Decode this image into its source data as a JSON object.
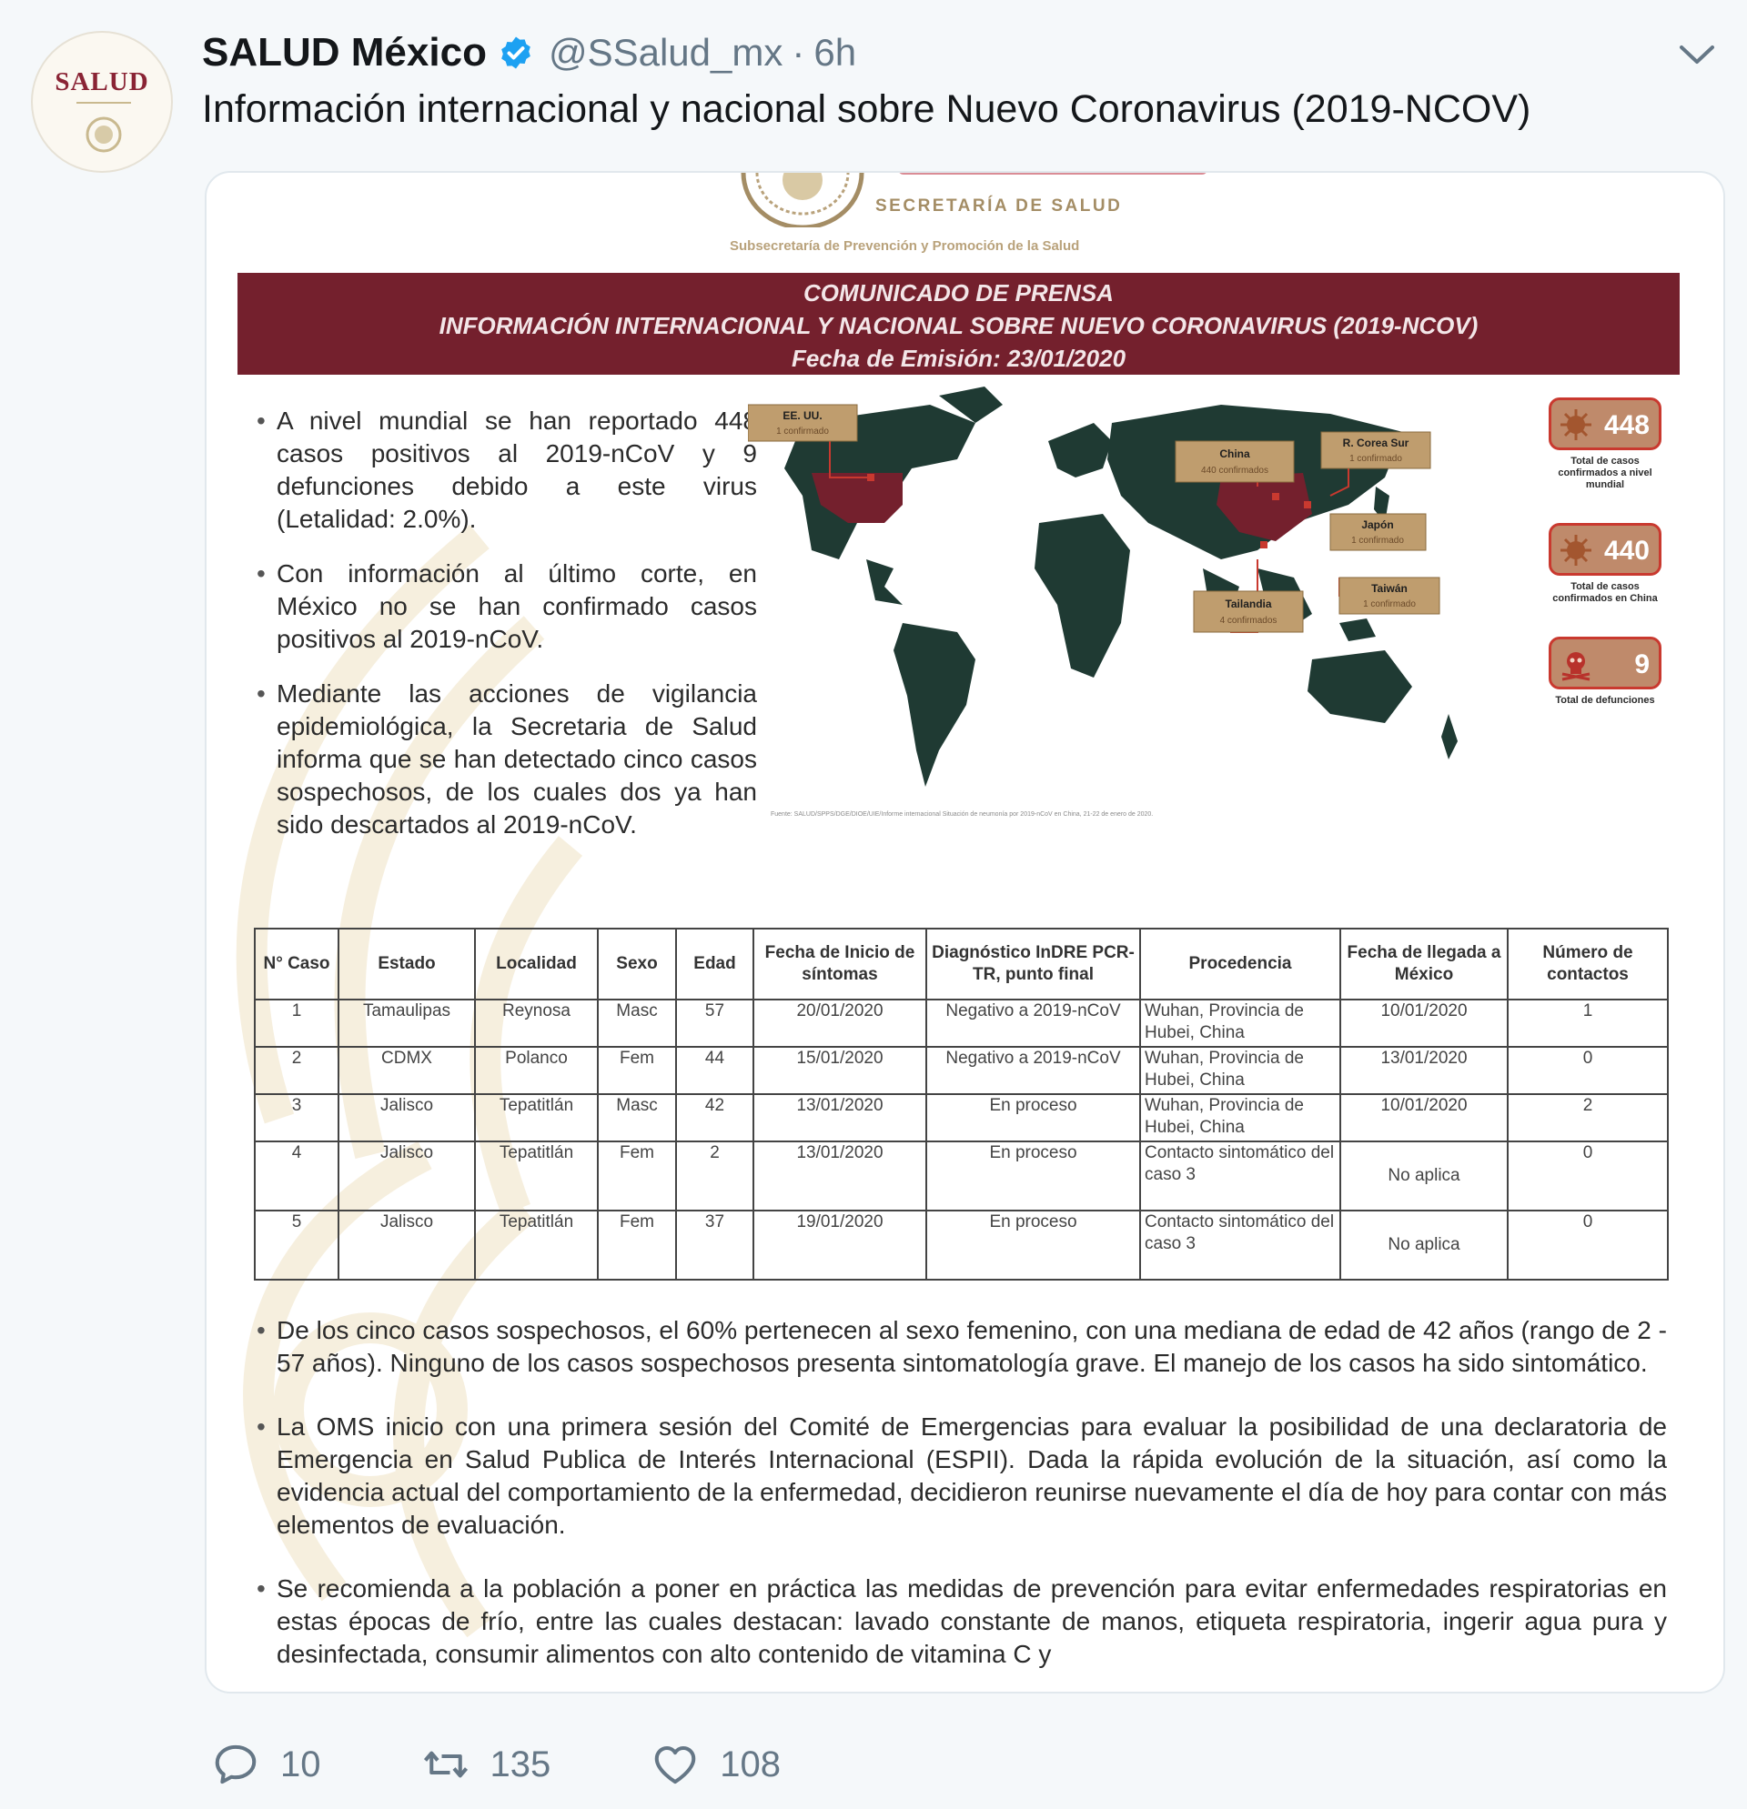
{
  "author": {
    "display_name": "SALUD México",
    "handle": "@SSalud_mx",
    "separator": "·",
    "time": "6h",
    "avatar_text": "SALUD"
  },
  "tweet_text": "Información internacional y nacional sobre Nuevo Coronavirus (2019-NCOV)",
  "document": {
    "org": "SECRETARÍA DE SALUD",
    "suborg": "Subsecretaría de Prevención y Promoción de la Salud",
    "banner": [
      "COMUNICADO DE PRENSA",
      "INFORMACIÓN INTERNACIONAL Y NACIONAL SOBRE NUEVO CORONAVIRUS (2019-NCOV)",
      "Fecha de Emisión: 23/01/2020"
    ],
    "bullets_top": [
      "A nivel mundial se han reportado 448 casos positivos al 2019-nCoV y 9 defunciones debido a este virus (Letalidad: 2.0%).",
      "Con información al último corte, en México no se han confirmado casos positivos al 2019-nCoV.",
      "Mediante las acciones de vigilancia epidemiológica, la Secretaria de Salud informa que se han detectado cinco casos sospechosos, de los cuales dos ya han sido descartados al 2019-nCoV."
    ],
    "map_labels": [
      {
        "name": "EE. UU.",
        "detail": "1 confirmado"
      },
      {
        "name": "China",
        "detail": "440 confirmados"
      },
      {
        "name": "R. Corea Sur",
        "detail": "1 confirmado"
      },
      {
        "name": "Japón",
        "detail": "1 confirmado"
      },
      {
        "name": "Tailandia",
        "detail": "4 confirmados"
      },
      {
        "name": "Taiwán",
        "detail": "1 confirmado"
      }
    ],
    "stats": [
      {
        "value": "448",
        "desc": "Total de casos confirmados a nivel mundial"
      },
      {
        "value": "440",
        "desc": "Total de casos confirmados en China"
      },
      {
        "value": "9",
        "desc": "Total de defunciones"
      }
    ],
    "source": "Fuente: SALUD/SPPS/DGE/DIOE/UIE/Informe internacional Situación de neumonía por 2019-nCoV en China, 21-22 de enero de 2020.",
    "table": {
      "headers": [
        "N° Caso",
        "Estado",
        "Localidad",
        "Sexo",
        "Edad",
        "Fecha de Inicio de síntomas",
        "Diagnóstico InDRE PCR-TR, punto final",
        "Procedencia",
        "Fecha de llegada a México",
        "Número de contactos"
      ],
      "rows": [
        [
          "1",
          "Tamaulipas",
          "Reynosa",
          "Masc",
          "57",
          "20/01/2020",
          "Negativo a 2019-nCoV",
          "Wuhan, Provincia de Hubei, China",
          "10/01/2020",
          "1"
        ],
        [
          "2",
          "CDMX",
          "Polanco",
          "Fem",
          "44",
          "15/01/2020",
          "Negativo a 2019-nCoV",
          "Wuhan, Provincia de Hubei, China",
          "13/01/2020",
          "0"
        ],
        [
          "3",
          "Jalisco",
          "Tepatitlán",
          "Masc",
          "42",
          "13/01/2020",
          "En proceso",
          "Wuhan, Provincia de Hubei, China",
          "10/01/2020",
          "2"
        ],
        [
          "4",
          "Jalisco",
          "Tepatitlán",
          "Fem",
          "2",
          "13/01/2020",
          "En proceso",
          "Contacto sintomático del caso 3",
          "No aplica",
          "0"
        ],
        [
          "5",
          "Jalisco",
          "Tepatitlán",
          "Fem",
          "37",
          "19/01/2020",
          "En proceso",
          "Contacto sintomático del caso 3",
          "No aplica",
          "0"
        ]
      ]
    },
    "bullets_bottom": [
      "De los cinco casos sospechosos, el 60% pertenecen al sexo femenino, con una mediana de edad de 42 años (rango de 2 - 57 años). Ninguno de los casos sospechosos presenta sintomatología grave. El manejo de los casos ha sido sintomático.",
      "La OMS inicio con una primera sesión del Comité de Emergencias para evaluar la posibilidad de una declaratoria de Emergencia en Salud Publica de Interés Internacional (ESPII). Dada la rápida evolución de la situación, así como la evidencia actual del comportamiento de la enfermedad, decidieron reunirse nuevamente el día de hoy para contar con más elementos de evaluación.",
      "Se recomienda a la población a poner en práctica las medidas de prevención para evitar enfermedades respiratorias en estas épocas de frío, entre las cuales destacan: lavado constante de manos, etiqueta respiratoria, ingerir agua pura y desinfectada, consumir alimentos con alto contenido de vitamina C y"
    ]
  },
  "actions": {
    "replies": "10",
    "retweets": "135",
    "likes": "108"
  },
  "colors": {
    "banner": "#74202d",
    "map_land": "#1f3a33",
    "highlight": "#74202d",
    "verified": "#1da1f2",
    "muted": "#657786"
  },
  "icons": [
    "verified-badge-icon",
    "chevron-down-icon",
    "reply-icon",
    "retweet-icon",
    "like-icon"
  ]
}
